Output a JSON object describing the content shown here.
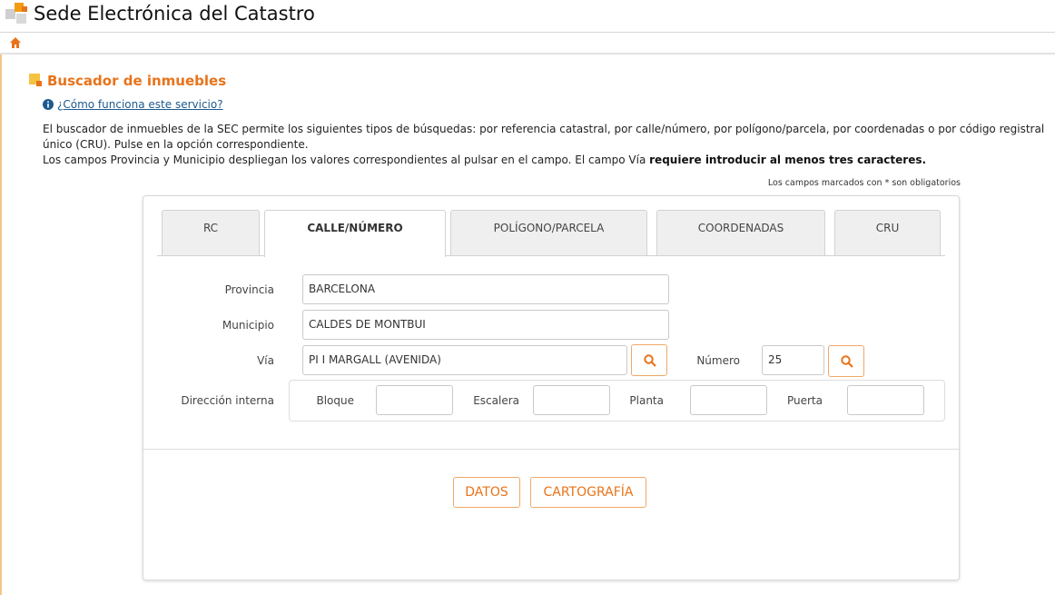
{
  "header": {
    "app_title": "Sede Electrónica del Catastro"
  },
  "nav": {
    "home_icon": "home-icon"
  },
  "section": {
    "title": "Buscador de inmuebles",
    "help_link": "¿Cómo funciona este servicio?",
    "intro_line1": "El buscador de inmuebles de la SEC permite los siguientes tipos de búsquedas: por referencia catastral, por calle/número, por polígono/parcela, por coordenadas o por código registral único (CRU). Pulse en la opción correspondiente.",
    "intro_line2_prefix": "Los campos Provincia y Municipio despliegan los valores correspondientes al pulsar en el campo. El campo Vía ",
    "intro_line2_bold": "requiere introducir al menos tres caracteres.",
    "required_note": "Los campos marcados con * son obligatorios"
  },
  "tabs": [
    {
      "label": "RC",
      "active": false
    },
    {
      "label": "CALLE/NÚMERO",
      "active": true
    },
    {
      "label": "POLÍGONO/PARCELA",
      "active": false
    },
    {
      "label": "COORDENADAS",
      "active": false
    },
    {
      "label": "CRU",
      "active": false
    }
  ],
  "form": {
    "provincia_label": "Provincia",
    "provincia_value": "BARCELONA",
    "municipio_label": "Municipio",
    "municipio_value": "CALDES DE MONTBUI",
    "via_label": "Vía",
    "via_value": "PI I MARGALL (AVENIDA)",
    "numero_label": "Número",
    "numero_value": "25",
    "direccion_label": "Dirección interna",
    "bloque_label": "Bloque",
    "bloque_value": "",
    "escalera_label": "Escalera",
    "escalera_value": "",
    "planta_label": "Planta",
    "planta_value": "",
    "puerta_label": "Puerta",
    "puerta_value": ""
  },
  "actions": {
    "datos": "DATOS",
    "cartografia": "CARTOGRAFÍA"
  },
  "colors": {
    "accent": "#e8731a",
    "link": "#1e5a8e"
  }
}
